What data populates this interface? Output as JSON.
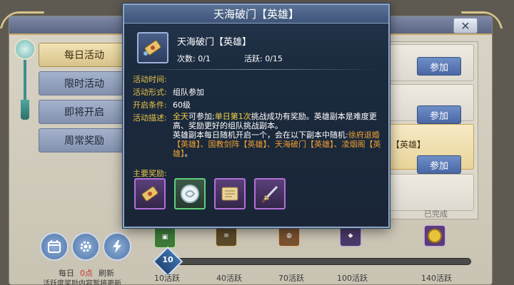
{
  "background": {
    "tabs": [
      "每日活动",
      "限时活动",
      "即将开启",
      "周常奖励"
    ],
    "active_tab": 0,
    "join_label": "参加",
    "hero_tag": "【英雄】",
    "done_label": "已完成",
    "close_label": "✕",
    "bottom": {
      "daily_prefix": "每日",
      "daily_points": "0点",
      "refresh": "刷新",
      "note": "活跃度奖励内容暂将更新"
    },
    "progress": {
      "current": 10,
      "current_label": "10",
      "fill_fraction": 0.04,
      "milestones": [
        "10活跃",
        "40活跃",
        "70活跃",
        "100活跃",
        "140活跃"
      ]
    }
  },
  "popup": {
    "title": "天海破门【英雄】",
    "item_name": "天海破门【英雄】",
    "count_label": "次数: 0/1",
    "activity_label": "活跃: 0/15",
    "info": {
      "time_label": "活动时间:",
      "time_value": "",
      "form_label": "活动形式:",
      "form_value": "组队参加",
      "cond_label": "开启条件:",
      "cond_value": "60级",
      "desc_label": "活动描述:",
      "desc": {
        "p1_a": "全天",
        "p1_b": "可参加;",
        "p1_c": "单日第1次",
        "p1_d": "挑战成功有奖励。英雄副本是难度更高、奖励更好的组队挑战副本。",
        "p2_a": "英雄副本每日随机开启一个，会在以下副本中随机:",
        "p2_b": "徐府退婚【英雄】、国教剑阵【英雄】、天海破门【英雄】、凌烟阁【英雄】",
        "p2_c": "。"
      }
    },
    "rewards_label": "主要奖励:",
    "rewards": [
      "scroll-ticket-icon",
      "spirit-orb-icon",
      "parchment-scroll-icon",
      "sword-icon"
    ]
  },
  "colors": {
    "popup_bg": "#1b2a3d",
    "label_gold": "#e7c24a",
    "highlight_orange": "#f0a030",
    "tab_active": "#f2e3b4",
    "join_blue": "#4a67a4"
  }
}
